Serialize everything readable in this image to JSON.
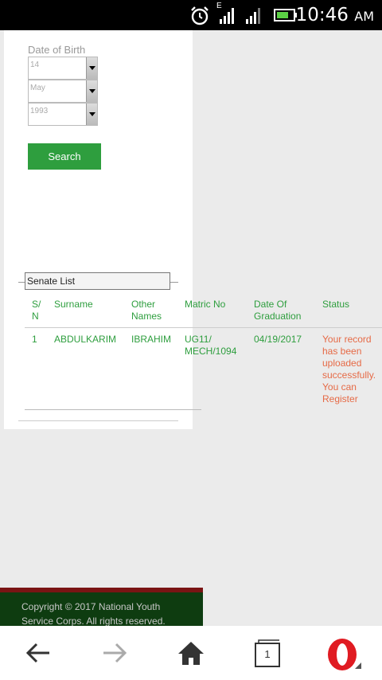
{
  "status_bar": {
    "time": "10:46",
    "ampm": "AM",
    "network": "E"
  },
  "form": {
    "dob_label": "Date of Birth",
    "day": "14",
    "month": "May",
    "year": "1993",
    "search_label": "Search"
  },
  "senate_list": {
    "legend": "Senate List",
    "headers": {
      "sn": [
        "S/",
        "N"
      ],
      "surname": "Surname",
      "other_names": [
        "Other",
        "Names"
      ],
      "matric_no": "Matric No",
      "date_grad": [
        "Date Of",
        "Graduation"
      ],
      "status": "Status"
    },
    "rows": [
      {
        "sn": "1",
        "surname": "ABDULKARIM",
        "other_names": "IBRAHIM",
        "matric": [
          "UG11/",
          "MECH/1094"
        ],
        "date": "04/19/2017",
        "status": [
          "Your record",
          "has been",
          "uploaded",
          "successfully.",
          "You can",
          "Register"
        ]
      }
    ]
  },
  "footer": {
    "line1": "Copyright © 2017 National Youth",
    "line2": "Service Corps. All rights reserved."
  },
  "nav": {
    "tab_count": "1"
  },
  "colors": {
    "accent_green": "#2e9e3e",
    "status_orange": "#e66a46",
    "footer_bg": "#0e3c10",
    "footer_bar": "#7a1414"
  }
}
